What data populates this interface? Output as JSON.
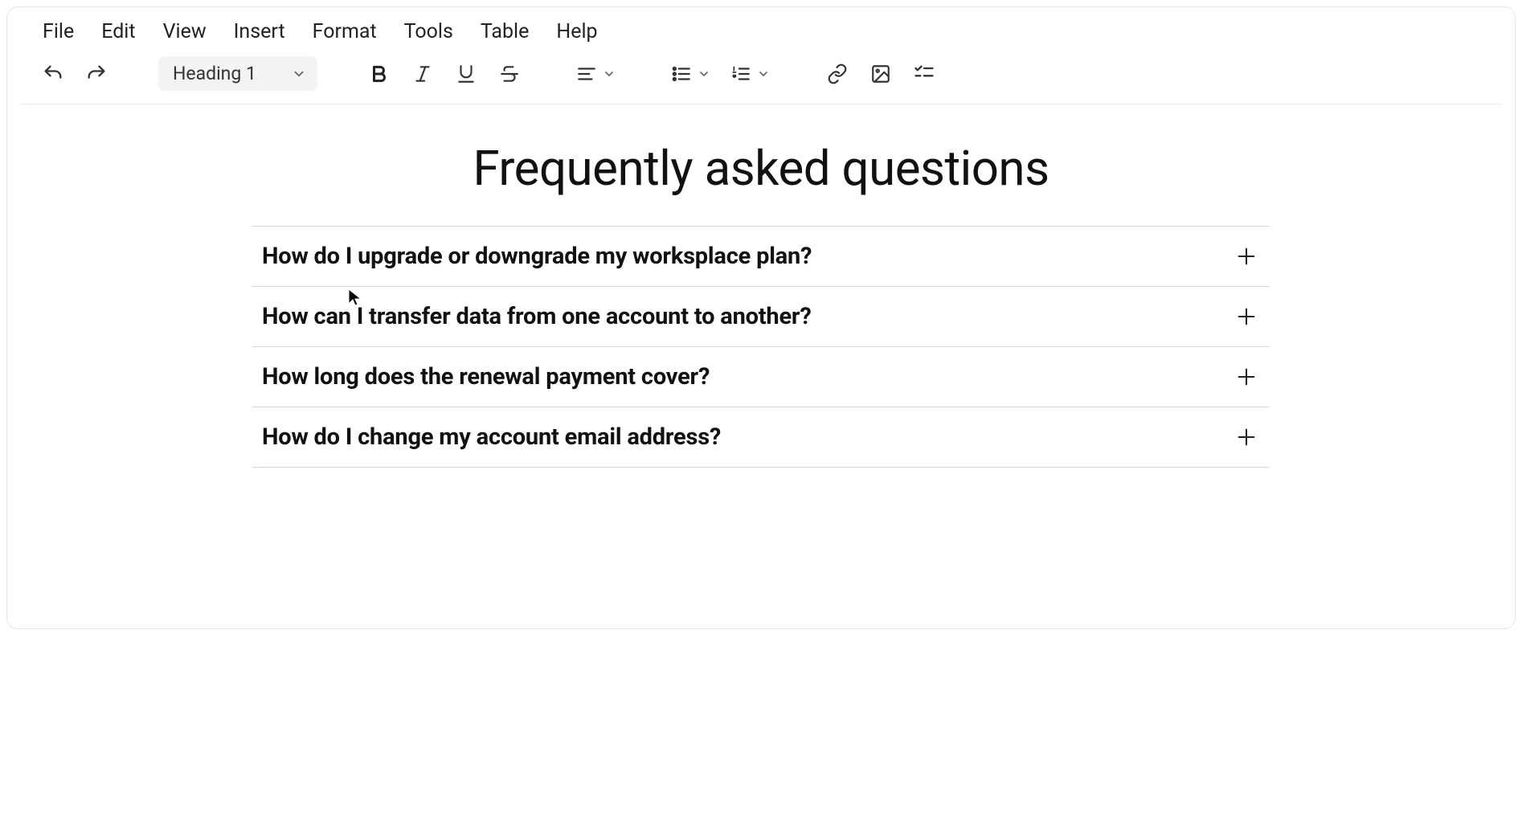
{
  "menubar": {
    "items": [
      "File",
      "Edit",
      "View",
      "Insert",
      "Format",
      "Tools",
      "Table",
      "Help"
    ]
  },
  "toolbar": {
    "format_select": "Heading 1"
  },
  "document": {
    "title": "Frequently asked questions",
    "faq": [
      {
        "question": "How do I upgrade or downgrade my worksplace plan?"
      },
      {
        "question": "How can I transfer data from one account to another?"
      },
      {
        "question": "How long does the renewal payment cover?"
      },
      {
        "question": "How do I change my account email address?"
      }
    ]
  }
}
